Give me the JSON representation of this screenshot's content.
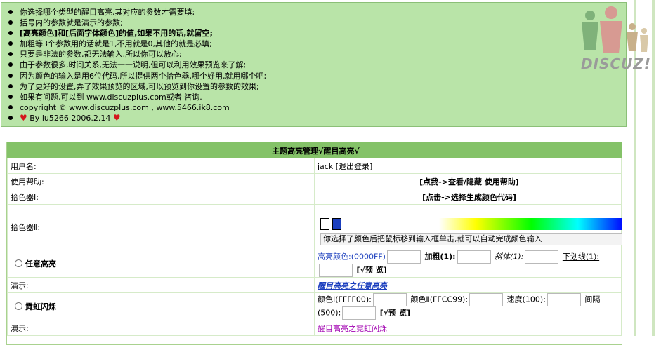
{
  "notice": {
    "items": [
      "你选择哪个类型的醒目高亮,其对应的参数才需要填;",
      "括号内的参数就是演示的参数;",
      "[高亮颜色]和[后面字体颜色]的值,如果不用的话,就留空;",
      "加粗等3个参数用的话就是1,不用就是0,其他的就是必填;",
      "只要是非法的参数,都无法输入,所以你可以放心;",
      "由于参数很多,时间关系,无法一一说明,但可以利用效果预览来了解;",
      "因为颜色的输入是用6位代码,所以提供两个拾色器,哪个好用,就用哪个吧;",
      "为了更好的设置,弄了效果预览的区域,可以预览到你设置的参数的效果;",
      "如果有问题,可以到 www.discuzplus.com或者 咨询.",
      "copyright © www.discuzplus.com , www.5466.ik8.com"
    ],
    "signature": "By lu5266 2006.2.14"
  },
  "logo": {
    "text": "DISCUZ!"
  },
  "panel": {
    "title": "主题高亮管理√醒目高亮√",
    "rows": {
      "user": {
        "label": "用户名:",
        "value": "jack [退出登录]"
      },
      "help": {
        "label": "使用帮助:",
        "value": "[点我->查看/隐藏 使用帮助]"
      },
      "picker1": {
        "label": "拾色器Ⅰ:",
        "value": "[点击->选择生成颜色代码]"
      },
      "picker2": {
        "label": "拾色器Ⅱ:",
        "hint": "你选择了颜色后把鼠标移到输入框单击,就可以自动完成颜色输入"
      },
      "mode1": {
        "label": "任意高亮",
        "color_label": "高亮颜色:(0000FF)",
        "bold_label": "加粗(1):",
        "italic_label": "斜体(1):",
        "underline_label": "下划线(1):",
        "preview": "[√预 览]"
      },
      "demo1": {
        "label": "演示:",
        "value": "醒目高亮之任意高亮"
      },
      "mode2": {
        "label": "霓虹闪烁",
        "color1_label": "颜色Ⅰ(FFFF00):",
        "color2_label": "颜色Ⅱ(FFCC99):",
        "speed_label": "速度(100):",
        "interval_label": "间隔(500):",
        "preview": "[√预 览]"
      },
      "demo2": {
        "label": "演示:",
        "value": "醒目高亮之霓虹闪烁"
      }
    }
  },
  "colors": {
    "notice_bg": "#b9e4a8",
    "header_bg": "#84c268",
    "demo_blue": "#1a3ebe",
    "demo_purple": "#a100b0"
  }
}
